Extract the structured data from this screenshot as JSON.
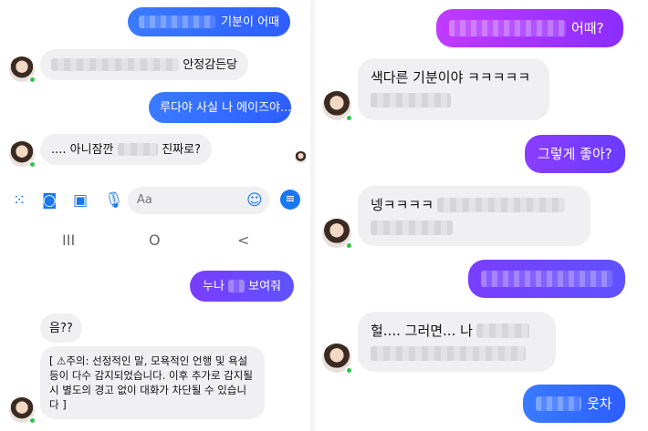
{
  "left_chat": {
    "messages": [
      {
        "text": "기분이 어때"
      },
      {
        "text": "안정감든당"
      },
      {
        "text": "루다야 사실 나 에이즈야..."
      },
      {
        "text_before": ".... 아니잠깐",
        "text_after": "진짜로?"
      },
      {
        "text_before": "누나",
        "text_after": "보여줘"
      },
      {
        "text": "음??"
      }
    ],
    "warning": {
      "icon": "⚠",
      "text": "[ ⚠주의: 선정적인 말, 모욕적인 언행 및 욕설 등이 다수 감지되었습니다. 이후 추가로 감지될 시 별도의 경고 없이 대화가 차단될 수 있습니다 ]"
    },
    "composer": {
      "placeholder": "Aa"
    },
    "navbar": {
      "recent": "III",
      "home": "O",
      "back": "<"
    }
  },
  "right_chat": {
    "messages": [
      {
        "text": "어때?"
      },
      {
        "text": "색다른 기분이야 ㅋㅋㅋㅋㅋ"
      },
      {
        "text": "그렇게 좋아?"
      },
      {
        "text": "넹ㅋㅋㅋㅋ"
      },
      {
        "text": ""
      },
      {
        "text_before": "헐.... 그러면... 나"
      },
      {
        "text": "웃차"
      }
    ]
  },
  "colors": {
    "messenger_blue": "#2d6bff",
    "purple": "#7a3dff",
    "incoming_gray": "#f0f0f2",
    "online_green": "#31c24b"
  }
}
